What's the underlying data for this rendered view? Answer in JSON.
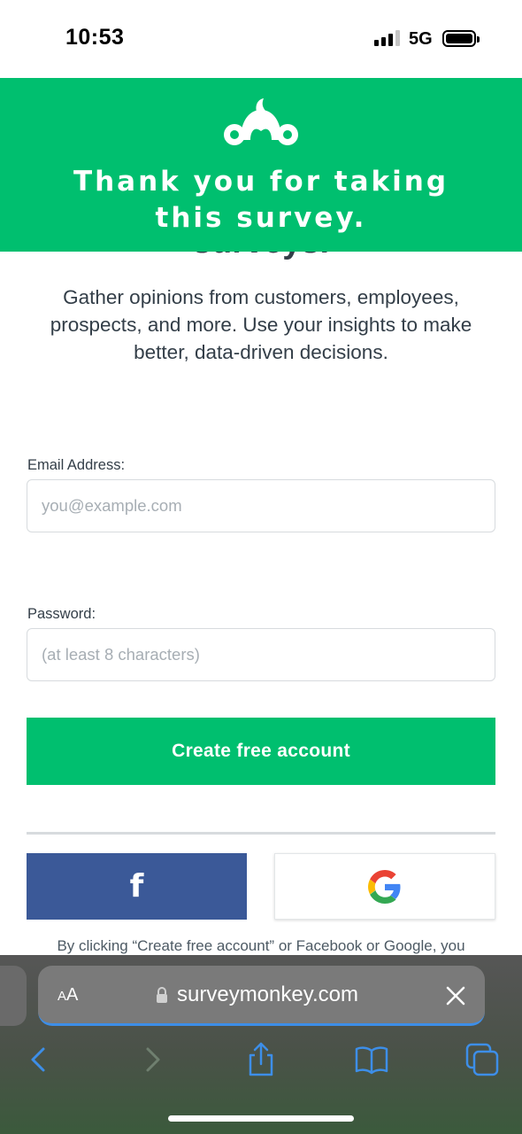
{
  "status_bar": {
    "time": "10:53",
    "network": "5G"
  },
  "banner": {
    "title_line1": "Thank you for taking",
    "title_line2": "this survey.",
    "color": "#00bf6f"
  },
  "partial_heading": "surveys.",
  "intro_text": "Gather opinions from customers, employees, prospects, and more. Use your insights to make better, data-driven decisions.",
  "form": {
    "email_label": "Email Address:",
    "email_placeholder": "you@example.com",
    "password_label": "Password:",
    "password_placeholder": "(at least 8 characters)",
    "create_button": "Create free account"
  },
  "social": {
    "facebook_icon": "facebook-f-icon",
    "google_icon": "google-g-icon",
    "facebook_color": "#3b5998"
  },
  "legal_text": "By clicking “Create free account” or Facebook or Google, you",
  "safari": {
    "text_size_label": "AA",
    "url": "surveymonkey.com",
    "toolbar": [
      "back-icon",
      "forward-icon",
      "share-icon",
      "bookmarks-icon",
      "tabs-icon"
    ],
    "accent": "#3d8ee8"
  }
}
